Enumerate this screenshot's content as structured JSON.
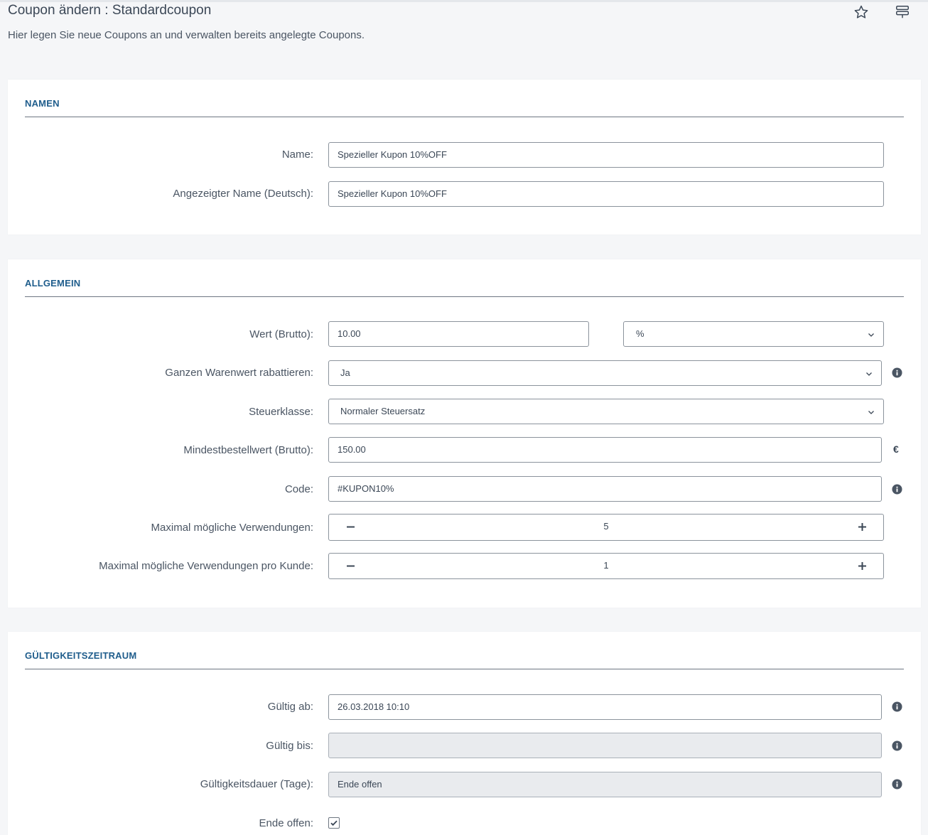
{
  "header": {
    "title": "Coupon ändern : Standardcoupon",
    "subtitle": "Hier legen Sie neue Coupons an und verwalten bereits angelegte Coupons.",
    "icons": [
      "star-icon",
      "menu-icon"
    ]
  },
  "sections": {
    "namen": {
      "title": "NAMEN",
      "name_label": "Name:",
      "name_value": "Spezieller Kupon 10%OFF",
      "display_name_label": "Angezeigter Name (Deutsch):",
      "display_name_value": "Spezieller Kupon 10%OFF"
    },
    "allgemein": {
      "title": "ALLGEMEIN",
      "wert_label": "Wert (Brutto):",
      "wert_value": "10.00",
      "wert_unit": "%",
      "rabatt_label": "Ganzen Warenwert rabattieren:",
      "rabatt_value": "Ja",
      "steuer_label": "Steuerklasse:",
      "steuer_value": "Normaler Steuersatz",
      "mindest_label": "Mindestbestellwert (Brutto):",
      "mindest_value": "150.00",
      "currency": "€",
      "code_label": "Code:",
      "code_value": "#KUPON10%",
      "max_label": "Maximal mögliche Verwendungen:",
      "max_value": "5",
      "max_kunde_label": "Maximal mögliche Verwendungen pro Kunde:",
      "max_kunde_value": "1"
    },
    "gueltigkeit": {
      "title": "GÜLTIGKEITSZEITRAUM",
      "ab_label": "Gültig ab:",
      "ab_value": "26.03.2018 10:10",
      "bis_label": "Gültig bis:",
      "bis_value": "",
      "dauer_label": "Gültigkeitsdauer (Tage):",
      "dauer_value": "Ende offen",
      "ende_label": "Ende offen:",
      "ende_checked": true
    }
  },
  "colors": {
    "accent": "#1f5d8c",
    "background": "#f5f6f8",
    "card": "#ffffff",
    "border": "#8b939c",
    "disabled": "#e9ebee"
  }
}
